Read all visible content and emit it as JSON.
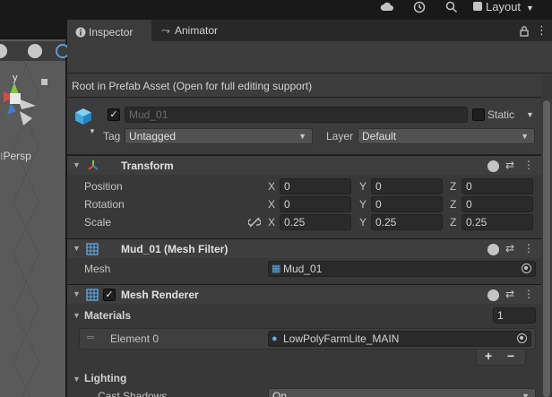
{
  "topbar": {
    "layout_label": "Layout",
    "icons": [
      "cloud-icon",
      "history-icon",
      "search-icon"
    ]
  },
  "scene": {
    "view_label": "Persp",
    "gizmo_axis": "y"
  },
  "tabs": [
    {
      "label": "Inspector",
      "icon": "info-icon",
      "active": true
    },
    {
      "label": "Animator",
      "icon": "animator-icon",
      "active": false
    }
  ],
  "prefab_note": "Root in Prefab Asset (Open for full editing support)",
  "gameobject": {
    "name": "Mud_01",
    "active": true,
    "static_label": "Static",
    "static": false,
    "tag_label": "Tag",
    "tag_value": "Untagged",
    "layer_label": "Layer",
    "layer_value": "Default"
  },
  "transform": {
    "title": "Transform",
    "rows": [
      {
        "label": "Position",
        "x": "0",
        "y": "0",
        "z": "0"
      },
      {
        "label": "Rotation",
        "x": "0",
        "y": "0",
        "z": "0"
      },
      {
        "label": "Scale",
        "x": "0.25",
        "y": "0.25",
        "z": "0.25"
      }
    ],
    "axis": {
      "x": "X",
      "y": "Y",
      "z": "Z"
    }
  },
  "mesh_filter": {
    "title": "Mud_01 (Mesh Filter)",
    "mesh_label": "Mesh",
    "mesh_value": "Mud_01"
  },
  "mesh_renderer": {
    "title": "Mesh Renderer",
    "enabled": true,
    "materials_label": "Materials",
    "materials_count": "1",
    "element_label": "Element 0",
    "element_value": "LowPolyFarmLite_MAIN",
    "add_label": "+",
    "remove_label": "−",
    "lighting_label": "Lighting",
    "cast_shadows_label": "Cast Shadows",
    "cast_shadows_value": "On"
  },
  "colors": {
    "inspector_bg": "#383838",
    "accent_blue": "#5e9cd8",
    "field_bg": "#2a2a2a"
  }
}
